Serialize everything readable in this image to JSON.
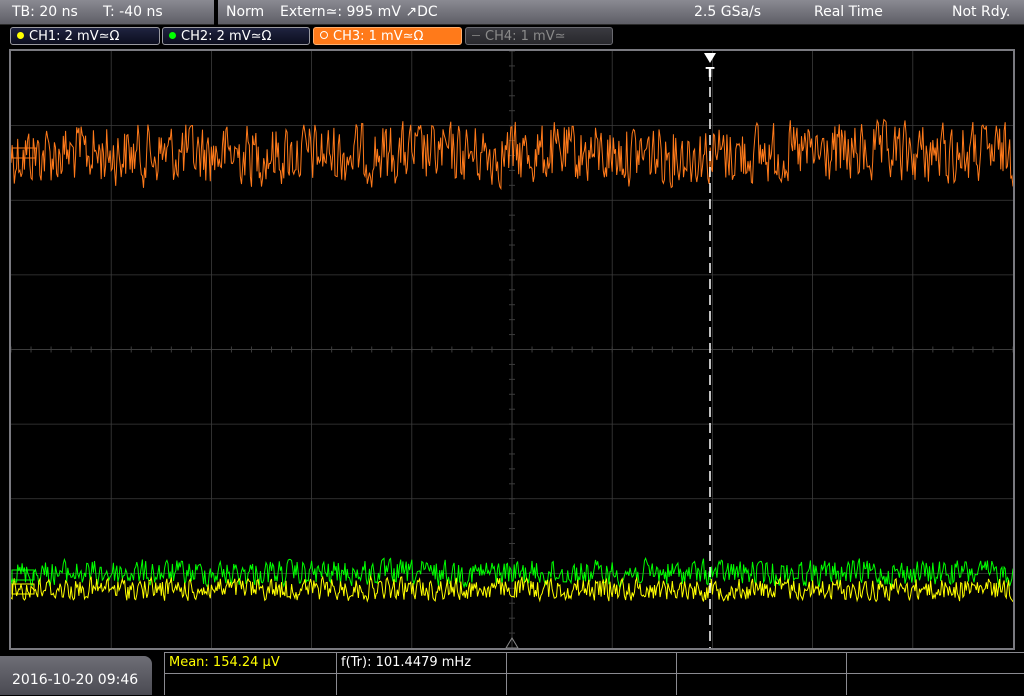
{
  "header": {
    "timebase": "TB: 20 ns",
    "trigger_time": "T: -40 ns",
    "mode": "Norm",
    "trigger": "Extern≃: 995 mV ↗DC",
    "sample_rate": "2.5 GSa/s",
    "acq_mode": "Real Time",
    "status": "Not Rdy."
  },
  "channels": [
    {
      "label": "CH1: 2 mV≃Ω",
      "color": "#ffff00",
      "state": "on"
    },
    {
      "label": "CH2: 2 mV≃Ω",
      "color": "#00ff00",
      "state": "on"
    },
    {
      "label": "CH3: 1 mV≃Ω",
      "color": "#ff7a1a",
      "state": "active"
    },
    {
      "label": "CH4: 1 mV≃",
      "color": "#888888",
      "state": "off"
    }
  ],
  "measurements": {
    "mean": "Mean: 154.24 µV",
    "freq": "f(Tr): 101.4479 mHz"
  },
  "datetime": "2016-10-20 09:46",
  "trigger_marker": "T",
  "colors": {
    "ch1": "#ffff00",
    "ch2": "#00ff00",
    "ch3": "#ff7a1a",
    "grid": "#3c3c3c"
  }
}
